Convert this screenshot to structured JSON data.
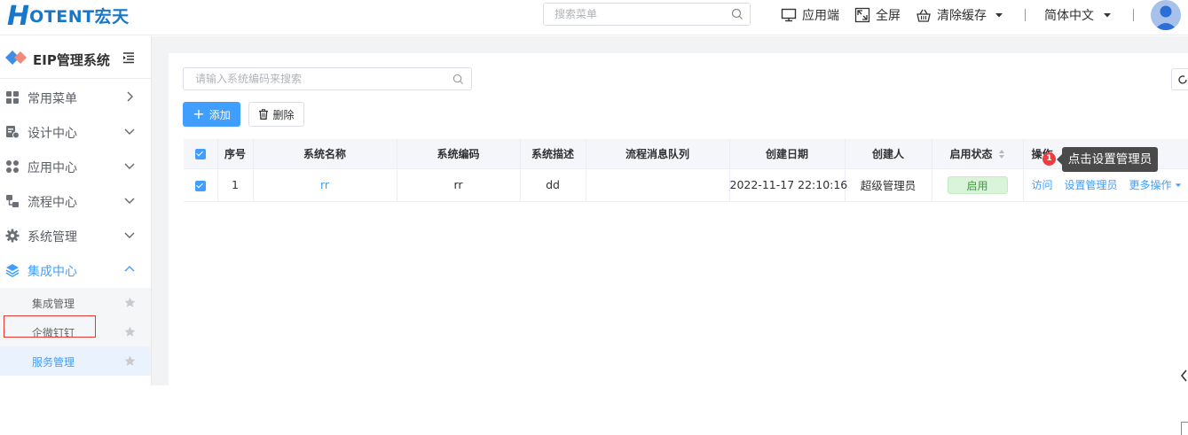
{
  "header": {
    "logo_h": "H",
    "logo_rest": "OTENT宏天",
    "search_placeholder": "搜索菜单",
    "app_end": "应用端",
    "fullscreen": "全屏",
    "clear_cache": "清除缓存",
    "language": "简体中文"
  },
  "sidebar": {
    "title": "EIP管理系统",
    "menu": [
      {
        "label": "常用菜单",
        "icon": "grid-icon"
      },
      {
        "label": "设计中心",
        "icon": "design-icon"
      },
      {
        "label": "应用中心",
        "icon": "apps-icon"
      },
      {
        "label": "流程中心",
        "icon": "flow-icon"
      },
      {
        "label": "系统管理",
        "icon": "gear-icon"
      },
      {
        "label": "集成中心",
        "icon": "layers-icon"
      }
    ],
    "submenu": [
      {
        "label": "集成管理"
      },
      {
        "label": "企微钉钉"
      },
      {
        "label": "服务管理"
      }
    ]
  },
  "toolbar": {
    "search_placeholder": "请输入系统编码来搜索",
    "add_label": "添加",
    "delete_label": "删除"
  },
  "table": {
    "headers": [
      "序号",
      "系统名称",
      "系统编码",
      "系统描述",
      "流程消息队列",
      "创建日期",
      "创建人",
      "启用状态",
      "操作"
    ],
    "rows": [
      {
        "index": "1",
        "name": "rr",
        "code": "rr",
        "desc": "dd",
        "queue": "",
        "created": "2022-11-17 22:10:16",
        "creator": "超级管理员",
        "status": "启用",
        "ops": [
          "访问",
          "设置管理员",
          "更多操作"
        ]
      }
    ]
  },
  "guide": {
    "step": "1",
    "tip": "点击设置管理员"
  },
  "colors": {
    "primary": "#409eff",
    "logo": "#1877c9",
    "tag_bg": "#d9f4d9",
    "tag_text": "#3a9e3a",
    "highlight_box": "#e53935",
    "badge": "#f03c3c"
  }
}
